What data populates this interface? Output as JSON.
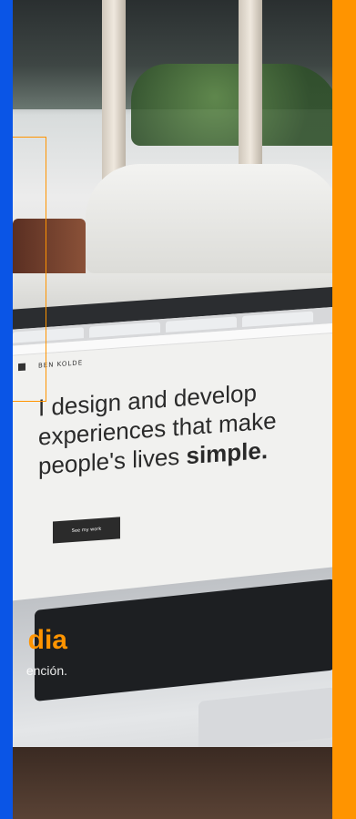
{
  "hero": {
    "laptop_screen": {
      "brand": "BEN KOLDE",
      "headline_line1": "I design and develop",
      "headline_line2": "experiences that make",
      "headline_line3_prefix": "people's lives ",
      "headline_line3_bold": "simple.",
      "cta_label": "See my work"
    },
    "slide": {
      "title": "dia",
      "subtitle": "ención."
    }
  },
  "colors": {
    "left_strip": "#0a55e6",
    "right_panel": "#ff9400",
    "accent": "#ff9400"
  }
}
